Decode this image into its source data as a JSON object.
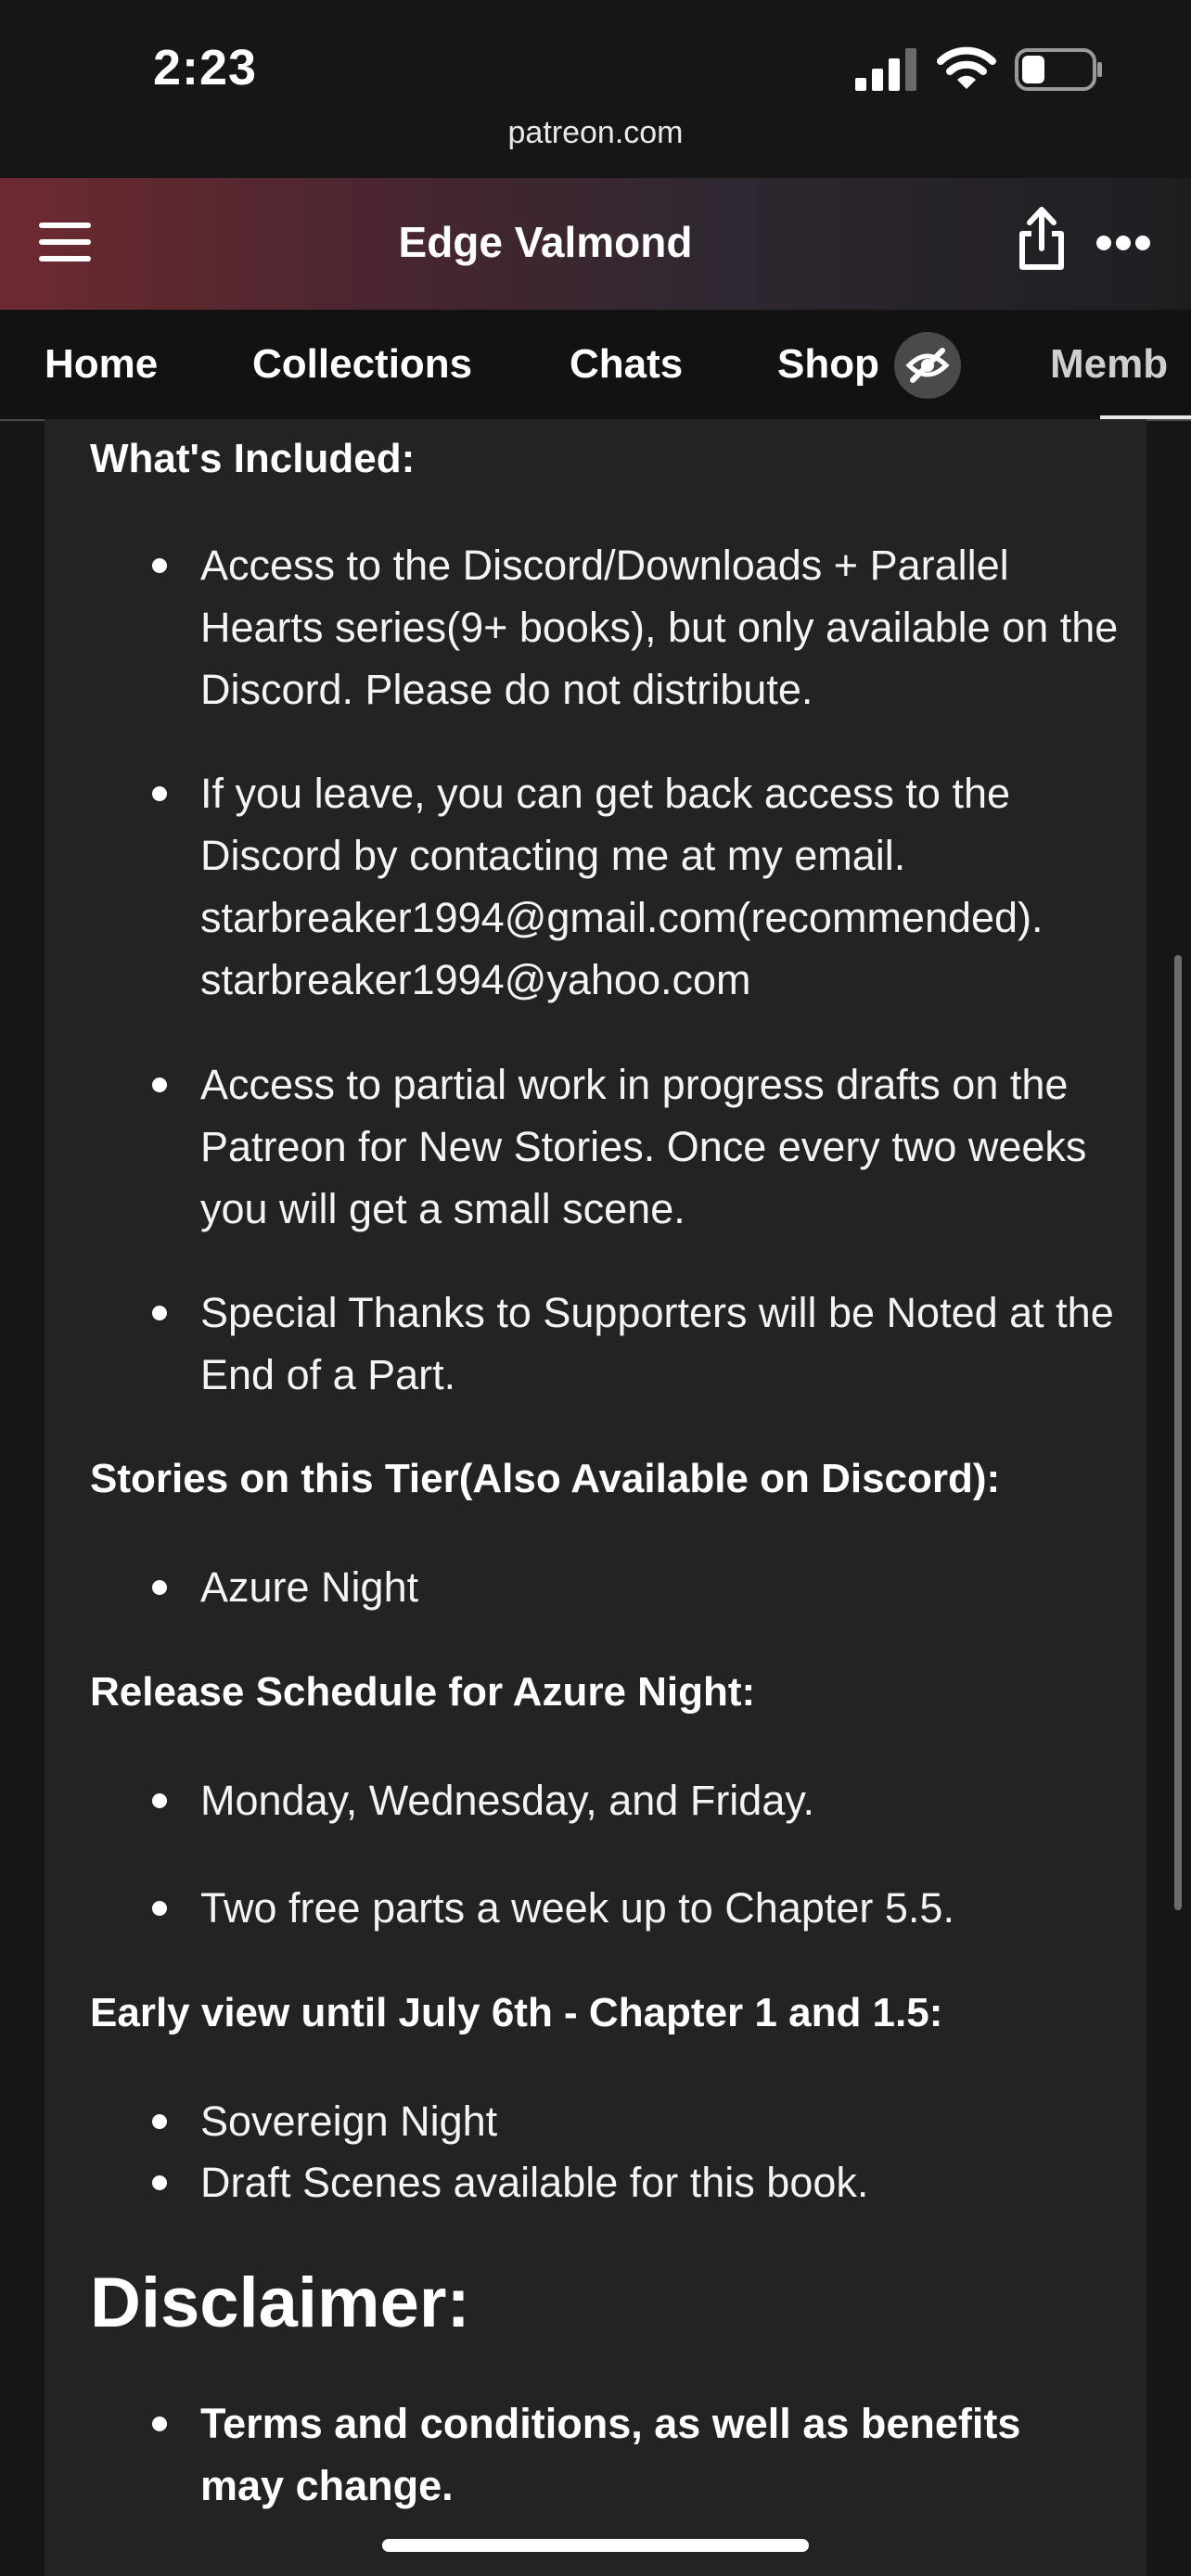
{
  "status": {
    "time": "2:23",
    "url": "patreon.com"
  },
  "header": {
    "title": "Edge Valmond"
  },
  "tabs": [
    "Home",
    "Collections",
    "Chats",
    "Shop",
    "Memb"
  ],
  "content": {
    "whats_included": {
      "heading": "What's Included:",
      "items": [
        "Access to the Discord/Downloads + Parallel Hearts series(9+ books), but only available on the Discord. Please do not distribute.",
        "If you leave, you can get back access to the Discord by contacting me at my email. starbreaker1994@gmail.com(recommended). starbreaker1994@yahoo.com",
        "Access to partial work in progress drafts on the Patreon for New Stories. Once every two weeks you will get a small scene.",
        "Special Thanks to Supporters will be Noted at the End of a Part."
      ]
    },
    "stories": {
      "heading": "Stories on this Tier(Also Available on Discord):",
      "items": [
        "Azure Night"
      ]
    },
    "release": {
      "heading": "Release Schedule for Azure Night:",
      "items": [
        "Monday, Wednesday, and Friday.",
        "Two free parts a week up to Chapter 5.5."
      ]
    },
    "early": {
      "heading": "Early view until July 6th - Chapter 1 and 1.5:",
      "items": [
        "Sovereign Night",
        "Draft Scenes available for this book."
      ]
    },
    "disclaimer": {
      "heading": "Disclaimer:",
      "items": [
        "Terms and conditions, as well as benefits may change."
      ]
    }
  },
  "icons": [
    "signal-icon",
    "wifi-icon",
    "battery-icon",
    "menu-icon",
    "share-icon",
    "more-icon",
    "eye-off-icon"
  ]
}
